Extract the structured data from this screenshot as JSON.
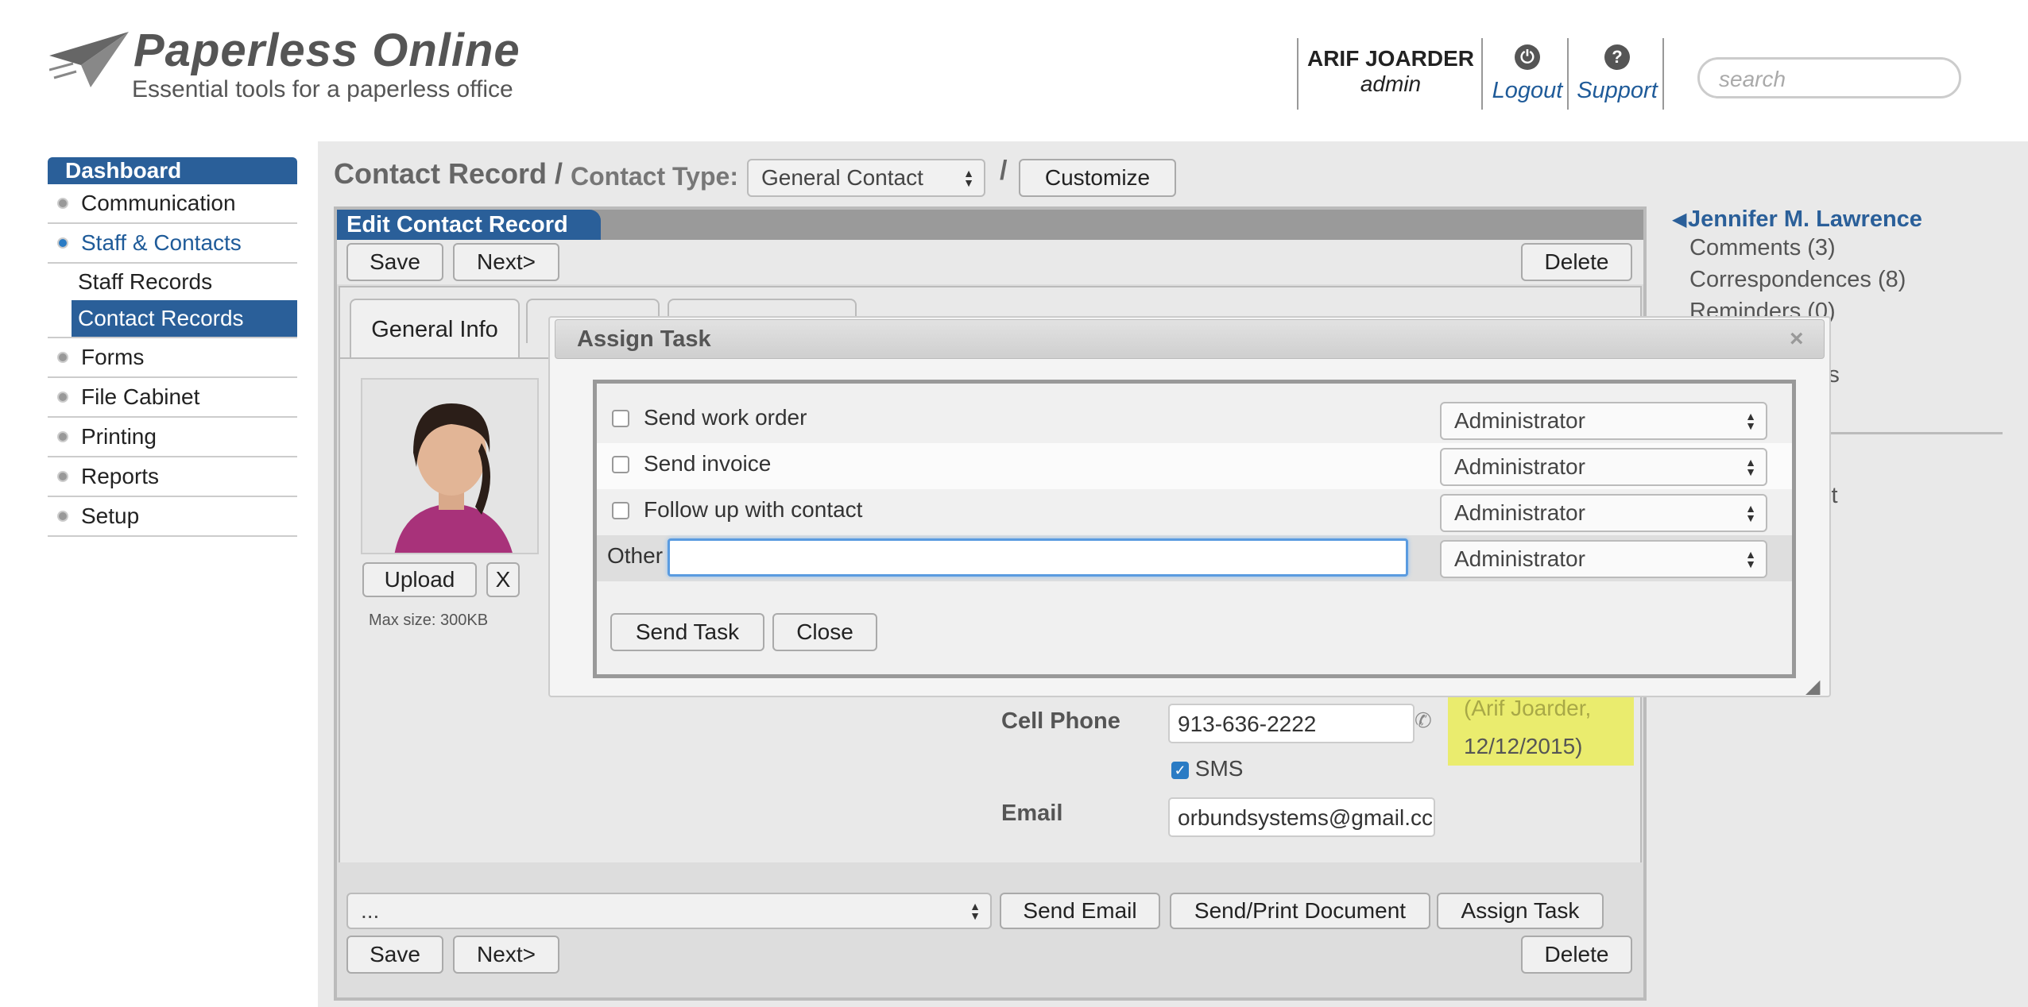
{
  "header": {
    "logo_title": "Paperless Online",
    "logo_subtitle": "Essential tools for a paperless office",
    "user_name": "ARIF JOARDER",
    "user_role": "admin",
    "logout_label": "Logout",
    "support_label": "Support",
    "search_placeholder": "search"
  },
  "sidebar": {
    "heading": "Dashboard",
    "items": [
      {
        "label": "Communication"
      },
      {
        "label": "Staff & Contacts"
      },
      {
        "label": "Forms"
      },
      {
        "label": "File Cabinet"
      },
      {
        "label": "Printing"
      },
      {
        "label": "Reports"
      },
      {
        "label": "Setup"
      }
    ],
    "subitems": [
      {
        "label": "Staff Records"
      },
      {
        "label": "Contact Records"
      }
    ]
  },
  "page": {
    "title": "Contact Record /",
    "contact_type_label": "Contact Type:",
    "contact_type_value": "General Contact",
    "slash": "/",
    "customize_label": "Customize"
  },
  "edit": {
    "heading": "Edit Contact Record",
    "save_label": "Save",
    "next_label": "Next>",
    "delete_label": "Delete",
    "tab_general": "General Info",
    "upload_label": "Upload",
    "remove_label": "X",
    "max_size": "Max size: 300KB",
    "cell_phone_label": "Cell Phone",
    "cell_phone_value": "913-636-2222",
    "sms_label": "SMS",
    "email_label": "Email",
    "email_value": "orbundsystems@gmail.cc",
    "note_line1": "(Arif Joarder,",
    "note_line2": "12/12/2015)",
    "action_select_value": "...",
    "send_email_label": "Send Email",
    "send_print_label": "Send/Print Document",
    "assign_task_label": "Assign Task"
  },
  "right": {
    "contact_name": "Jennifer M. Lawrence",
    "comments": "Comments (3)",
    "correspondences": "Correspondences (8)",
    "reminders": "Reminders (0)",
    "attachments_partial": "ents",
    "contact_partial": "ct"
  },
  "modal": {
    "title": "Assign Task",
    "close_icon": "×",
    "tasks": [
      {
        "label": "Send work order",
        "assignee": "Administrator",
        "checked": false
      },
      {
        "label": "Send invoice",
        "assignee": "Administrator",
        "checked": false
      },
      {
        "label": "Follow up with contact",
        "assignee": "Administrator",
        "checked": false
      }
    ],
    "other_label": "Other",
    "other_value": "",
    "other_assignee": "Administrator",
    "send_task_label": "Send Task",
    "close_label": "Close"
  },
  "colors": {
    "brand_blue": "#2a5f99",
    "link_blue": "#1f5b99",
    "note_yellow": "#eaec6e"
  }
}
